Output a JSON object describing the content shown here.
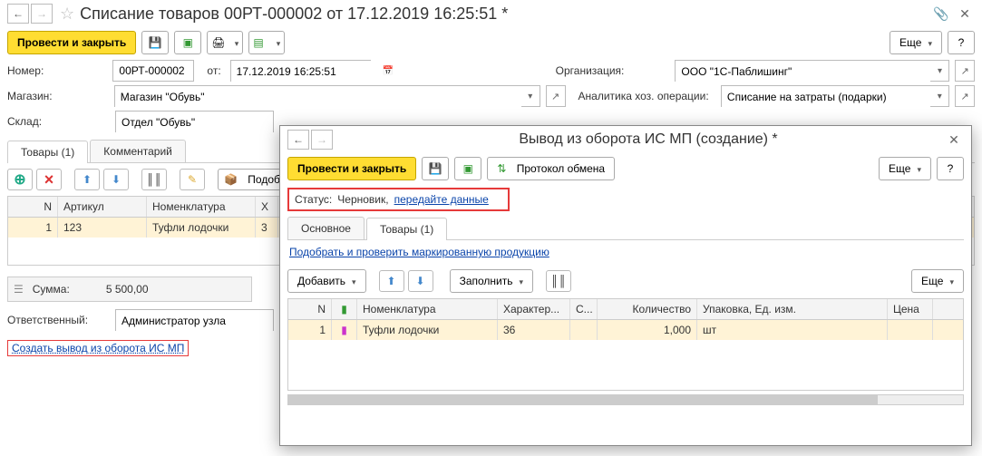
{
  "main": {
    "title": "Списание товаров 00РТ-000002 от 17.12.2019 16:25:51 *",
    "buttons": {
      "post_close": "Провести и закрыть",
      "more": "Еще"
    },
    "fields": {
      "number_label": "Номер:",
      "number_value": "00РТ-000002",
      "from_label": "от:",
      "date_value": "17.12.2019 16:25:51",
      "org_label": "Организация:",
      "org_value": "ООО \"1С-Паблишинг\"",
      "store_label": "Магазин:",
      "store_value": "Магазин \"Обувь\"",
      "analytics_label": "Аналитика хоз. операции:",
      "analytics_value": "Списание на затраты (подарки)",
      "warehouse_label": "Склад:",
      "warehouse_value": "Отдел \"Обувь\""
    },
    "tabs": {
      "goods": "Товары (1)",
      "comment": "Комментарий"
    },
    "table_toolbar": {
      "pick": "Подобра"
    },
    "grid": {
      "headers": {
        "n": "N",
        "art": "Артикул",
        "nom": "Номенклатура",
        "x": "Х"
      },
      "row": {
        "n": "1",
        "art": "123",
        "nom": "Туфли лодочки",
        "x": "3"
      }
    },
    "sum_label": "Сумма:",
    "sum_value": "5 500,00",
    "resp_label": "Ответственный:",
    "resp_value": "Администратор узла",
    "create_link": "Создать вывод из оборота ИС МП"
  },
  "modal": {
    "title": "Вывод из оборота ИС МП (создание) *",
    "post_close": "Провести и закрыть",
    "protocol": "Протокол обмена",
    "more": "Еще",
    "status_label": "Статус:",
    "status_value": "Черновик,",
    "status_link": "передайте данные",
    "tabs": {
      "main": "Основное",
      "goods": "Товары (1)"
    },
    "pick_link": "Подобрать и проверить маркированную продукцию",
    "add_btn": "Добавить",
    "fill_btn": "Заполнить",
    "grid": {
      "headers": {
        "n": "N",
        "nom": "Номенклатура",
        "char": "Характер...",
        "s": "С...",
        "qty": "Количество",
        "pack": "Упаковка, Ед. изм.",
        "price": "Цена"
      },
      "row": {
        "n": "1",
        "nom": "Туфли лодочки",
        "char": "36",
        "s": "",
        "qty": "1,000",
        "pack": "шт"
      }
    }
  }
}
